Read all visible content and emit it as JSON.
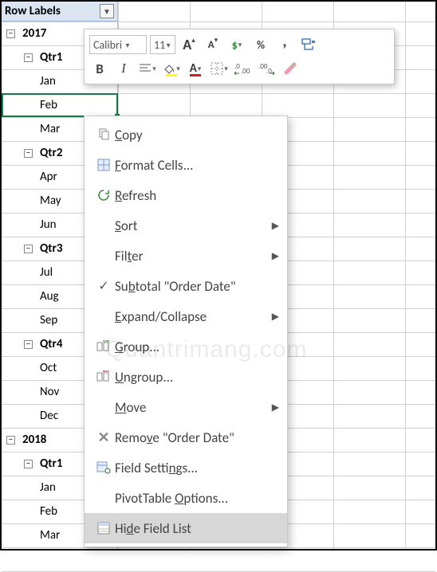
{
  "header": {
    "label": "Row Labels"
  },
  "rows": [
    {
      "t": "year",
      "v": "2017"
    },
    {
      "t": "qtr",
      "v": "Qtr1"
    },
    {
      "t": "month",
      "v": "Jan"
    },
    {
      "t": "month",
      "v": "Feb"
    },
    {
      "t": "month",
      "v": "Mar"
    },
    {
      "t": "qtr",
      "v": "Qtr2"
    },
    {
      "t": "month",
      "v": "Apr"
    },
    {
      "t": "month",
      "v": "May"
    },
    {
      "t": "month",
      "v": "Jun"
    },
    {
      "t": "qtr",
      "v": "Qtr3"
    },
    {
      "t": "month",
      "v": "Jul"
    },
    {
      "t": "month",
      "v": "Aug"
    },
    {
      "t": "month",
      "v": "Sep"
    },
    {
      "t": "qtr",
      "v": "Qtr4"
    },
    {
      "t": "month",
      "v": "Oct"
    },
    {
      "t": "month",
      "v": "Nov"
    },
    {
      "t": "month",
      "v": "Dec"
    },
    {
      "t": "year",
      "v": "2018"
    },
    {
      "t": "qtr",
      "v": "Qtr1"
    },
    {
      "t": "month",
      "v": "Jan"
    },
    {
      "t": "month",
      "v": "Feb"
    },
    {
      "t": "month",
      "v": "Mar"
    }
  ],
  "minitoolbar": {
    "font": "Calibri",
    "size": "11"
  },
  "context": {
    "copy": "Copy",
    "format": "Format Cells...",
    "refresh": "Refresh",
    "sort": "Sort",
    "filter": "Filter",
    "subtotal": "Subtotal \"Order Date\"",
    "expand": "Expand/Collapse",
    "group": "Group...",
    "ungroup": "Ungroup...",
    "move": "Move",
    "remove": "Remove \"Order Date\"",
    "fieldsettings": "Field Settings...",
    "ptoptions": "PivotTable Options...",
    "hidefl": "Hide Field List"
  },
  "watermark": "Quantrimang.com"
}
